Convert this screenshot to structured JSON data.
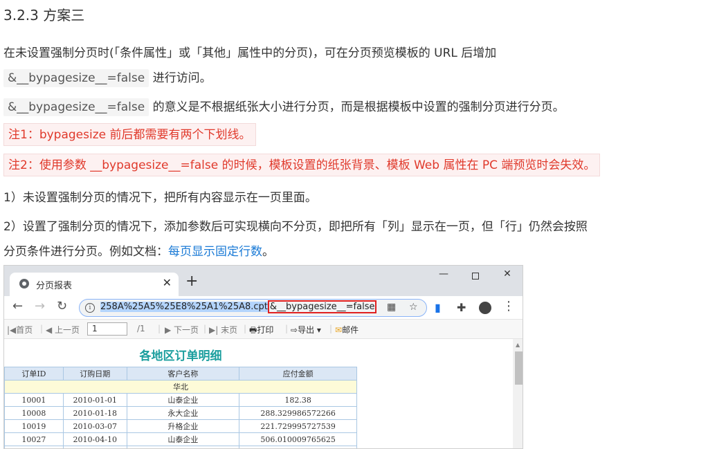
{
  "heading": "3.2.3 方案三",
  "para1": {
    "line1": "在未设置强制分页时(「条件属性」或「其他」属性中的分页)，可在分页预览模板的 URL 后增加",
    "code": "&__bypagesize__=false",
    "line2_suffix": "进行访问。"
  },
  "para2": {
    "code": "&__bypagesize__=false",
    "suffix": "的意义是不根据纸张大小进行分页，而是根据模板中设置的强制分页进行分页。"
  },
  "notes": [
    "注1：bypagesize 前后都需要有两个下划线。",
    "注2：使用参数 __bypagesize__=false 的时候，模板设置的纸张背景、模板 Web 属性在 PC 端预览时会失效。"
  ],
  "item1": "1）未设置强制分页的情况下，把所有内容显示在一页里面。",
  "item2": {
    "line1": "2）设置了强制分页的情况下，添加参数后可实现横向不分页，即把所有「列」显示在一页，但「行」仍然会按照",
    "line2_prefix": "分页条件进行分页。例如文档：",
    "link": "每页显示固定行数",
    "line2_suffix": "。"
  },
  "browser": {
    "tab_title": "分页报表",
    "url_selected": "258A%25A5%25E8%25A1%25A8.cpt",
    "url_param": "&__bypagesize__=false",
    "toolbar": {
      "first": "首页",
      "prev": "上一页",
      "page_value": "1",
      "page_total": "/1",
      "next": "下一页",
      "last": "末页",
      "print": "打印",
      "export": "导出",
      "mail": "邮件"
    },
    "report": {
      "title": "各地区订单明细",
      "headers": [
        "订单ID",
        "订购日期",
        "客户名称",
        "应付金额"
      ],
      "region": "华北",
      "rows": [
        [
          "10001",
          "2010-01-01",
          "山泰企业",
          "182.38"
        ],
        [
          "10008",
          "2010-01-18",
          "永大企业",
          "288.329986572266"
        ],
        [
          "10019",
          "2010-03-07",
          "升格企业",
          "221.729995727539"
        ],
        [
          "10027",
          "2010-04-10",
          "山泰企业",
          "506.010009765625"
        ]
      ]
    }
  }
}
